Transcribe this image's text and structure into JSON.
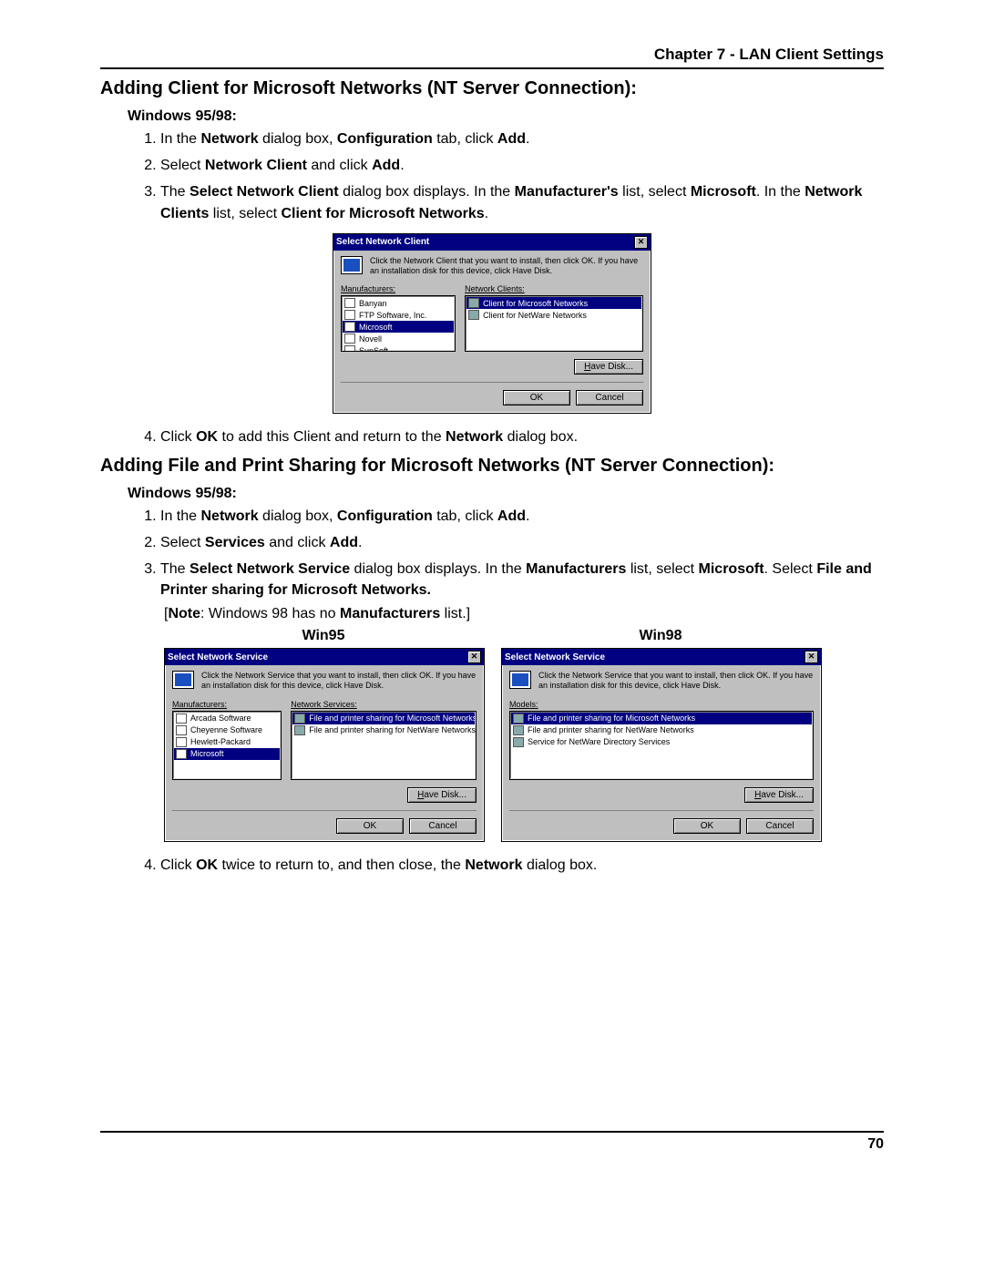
{
  "chapter": "Chapter 7 - LAN Client Settings",
  "section1": {
    "title": "Adding Client for Microsoft Networks (NT Server Connection):",
    "os": "Windows 95/98:",
    "steps": {
      "s1_a": "In the ",
      "s1_b": "Network",
      "s1_c": " dialog box, ",
      "s1_d": "Configuration",
      "s1_e": " tab, click ",
      "s1_f": "Add",
      "s1_g": ".",
      "s2_a": "Select ",
      "s2_b": "Network Client",
      "s2_c": " and click ",
      "s2_d": "Add",
      "s2_e": ".",
      "s3_a": "The ",
      "s3_b": "Select Network Client",
      "s3_c": " dialog box displays. In the ",
      "s3_d": "Manufacturer's",
      "s3_e": " list, select ",
      "s3_f": "Microsoft",
      "s3_g": ". In the ",
      "s3_h": "Network Clients",
      "s3_i": " list, select ",
      "s3_j": "Client for Microsoft Networks",
      "s3_k": ".",
      "s4_a": "Click ",
      "s4_b": "OK",
      "s4_c": " to add this Client and return to the ",
      "s4_d": "Network",
      "s4_e": " dialog box."
    }
  },
  "dialog1": {
    "title": "Select Network Client",
    "instruct": "Click the Network Client that you want to install, then click OK. If you have an installation disk for this device, click Have Disk.",
    "left_label": "Manufacturers:",
    "right_label": "Network Clients:",
    "manufacturers": [
      "Banyan",
      "FTP Software, Inc.",
      "Microsoft",
      "Novell",
      "SunSoft"
    ],
    "manufacturer_sel": "Microsoft",
    "clients": [
      "Client for Microsoft Networks",
      "Client for NetWare Networks"
    ],
    "client_sel": "Client for Microsoft Networks",
    "have_disk": "Have Disk...",
    "ok": "OK",
    "cancel": "Cancel"
  },
  "section2": {
    "title": "Adding File and Print Sharing for Microsoft Networks (NT Server Connection):",
    "os": "Windows 95/98:",
    "steps": {
      "s1_a": "In the ",
      "s1_b": "Network",
      "s1_c": " dialog box, ",
      "s1_d": "Configuration",
      "s1_e": " tab, click ",
      "s1_f": "Add",
      "s1_g": ".",
      "s2_a": "Select ",
      "s2_b": "Services",
      "s2_c": " and click ",
      "s2_d": "Add",
      "s2_e": ".",
      "s3_a": "The ",
      "s3_b": "Select Network Service",
      "s3_c": " dialog box displays. In the ",
      "s3_d": "Manufacturers",
      "s3_e": " list, select ",
      "s3_f": "Microsoft",
      "s3_g": ". Select ",
      "s3_h": "File and Printer sharing for Microsoft Networks.",
      "s4_a": "Click ",
      "s4_b": "OK",
      "s4_c": " twice to return to, and then close, the ",
      "s4_d": "Network",
      "s4_e": " dialog box."
    },
    "note_a": "[",
    "note_b": "Note",
    "note_c": ": Windows 98 has no ",
    "note_d": "Manufacturers",
    "note_e": " list.]"
  },
  "col_labels": {
    "left": "Win95",
    "right": "Win98"
  },
  "dialog2": {
    "title": "Select Network Service",
    "instruct": "Click the Network Service that you want to install, then click OK. If you have an installation disk for this device, click Have Disk.",
    "left_label": "Manufacturers:",
    "right_label": "Network Services:",
    "manufacturers": [
      "Arcada Software",
      "Cheyenne Software",
      "Hewlett-Packard",
      "Microsoft"
    ],
    "manufacturer_sel": "Microsoft",
    "services": [
      "File and printer sharing for Microsoft Networks",
      "File and printer sharing for NetWare Networks"
    ],
    "service_sel": "File and printer sharing for Microsoft Networks",
    "have_disk": "Have Disk...",
    "ok": "OK",
    "cancel": "Cancel"
  },
  "dialog3": {
    "title": "Select Network Service",
    "instruct": "Click the Network Service that you want to install, then click OK. If you have an installation disk for this device, click Have Disk.",
    "models_label": "Models:",
    "models": [
      "File and printer sharing for Microsoft Networks",
      "File and printer sharing for NetWare Networks",
      "Service for NetWare Directory Services"
    ],
    "model_sel": "File and printer sharing for Microsoft Networks",
    "have_disk": "Have Disk...",
    "ok": "OK",
    "cancel": "Cancel"
  },
  "page_number": "70"
}
